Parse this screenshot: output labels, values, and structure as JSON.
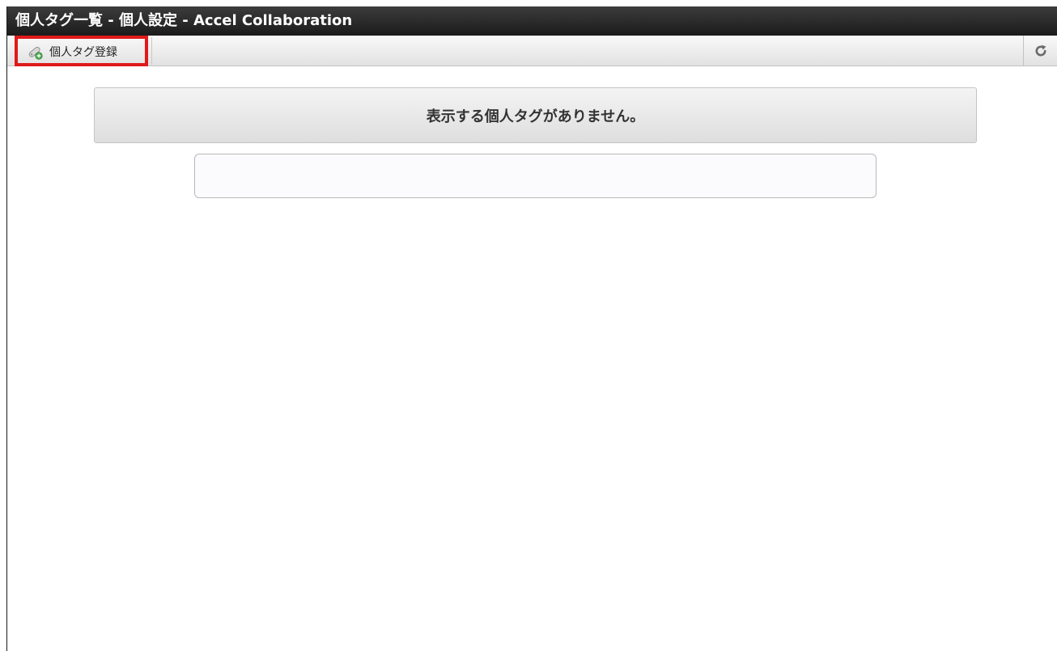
{
  "window": {
    "title": "個人タグ一覧 - 個人設定 - Accel Collaboration"
  },
  "toolbar": {
    "register_label": "個人タグ登録",
    "register_icon": "tag-add-icon",
    "refresh_icon": "refresh-icon",
    "highlight_color": "#e01919"
  },
  "main": {
    "empty_message": "表示する個人タグがありません。"
  }
}
